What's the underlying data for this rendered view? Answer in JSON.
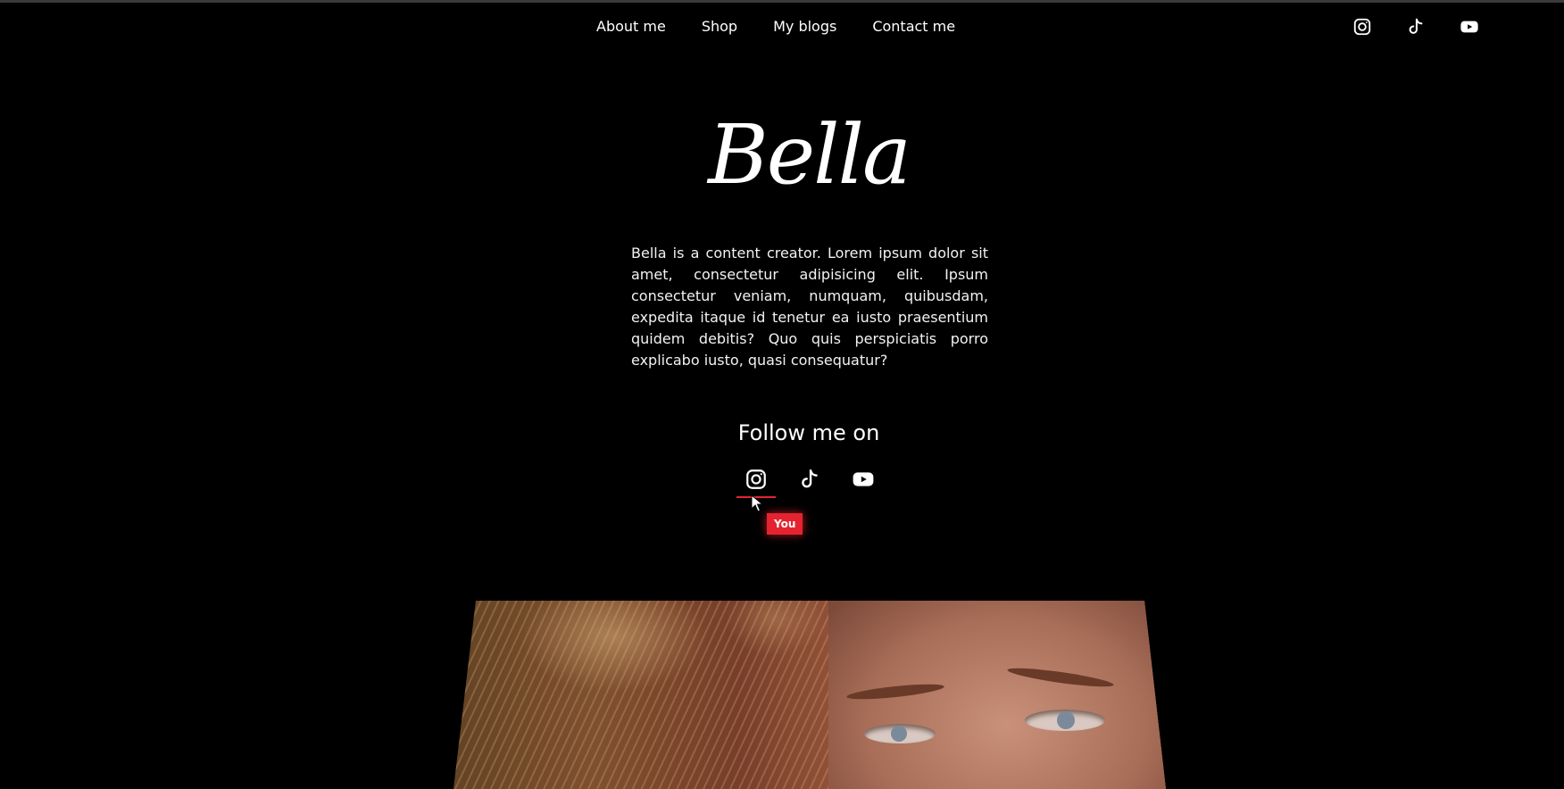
{
  "nav": {
    "links": [
      {
        "label": "About me"
      },
      {
        "label": "Shop"
      },
      {
        "label": "My blogs"
      },
      {
        "label": "Contact me"
      }
    ],
    "social_icons": [
      "instagram-icon",
      "tiktok-icon",
      "youtube-icon"
    ]
  },
  "hero": {
    "brand": "Bella",
    "bio": "Bella is a content creator. Lorem ipsum dolor sit amet, consectetur adipisicing elit. Ipsum consectetur veniam, numquam, quibusdam, expedita itaque id tenetur ea iusto praesentium quidem debitis? Quo quis perspiciatis porro explicabo iusto, quasi consequatur?"
  },
  "follow": {
    "heading": "Follow me on",
    "icons": [
      "instagram-icon",
      "tiktok-icon",
      "youtube-icon"
    ],
    "tooltip": "You"
  },
  "colors": {
    "background": "#000000",
    "text": "#ffffff",
    "accent": "#e52330"
  }
}
